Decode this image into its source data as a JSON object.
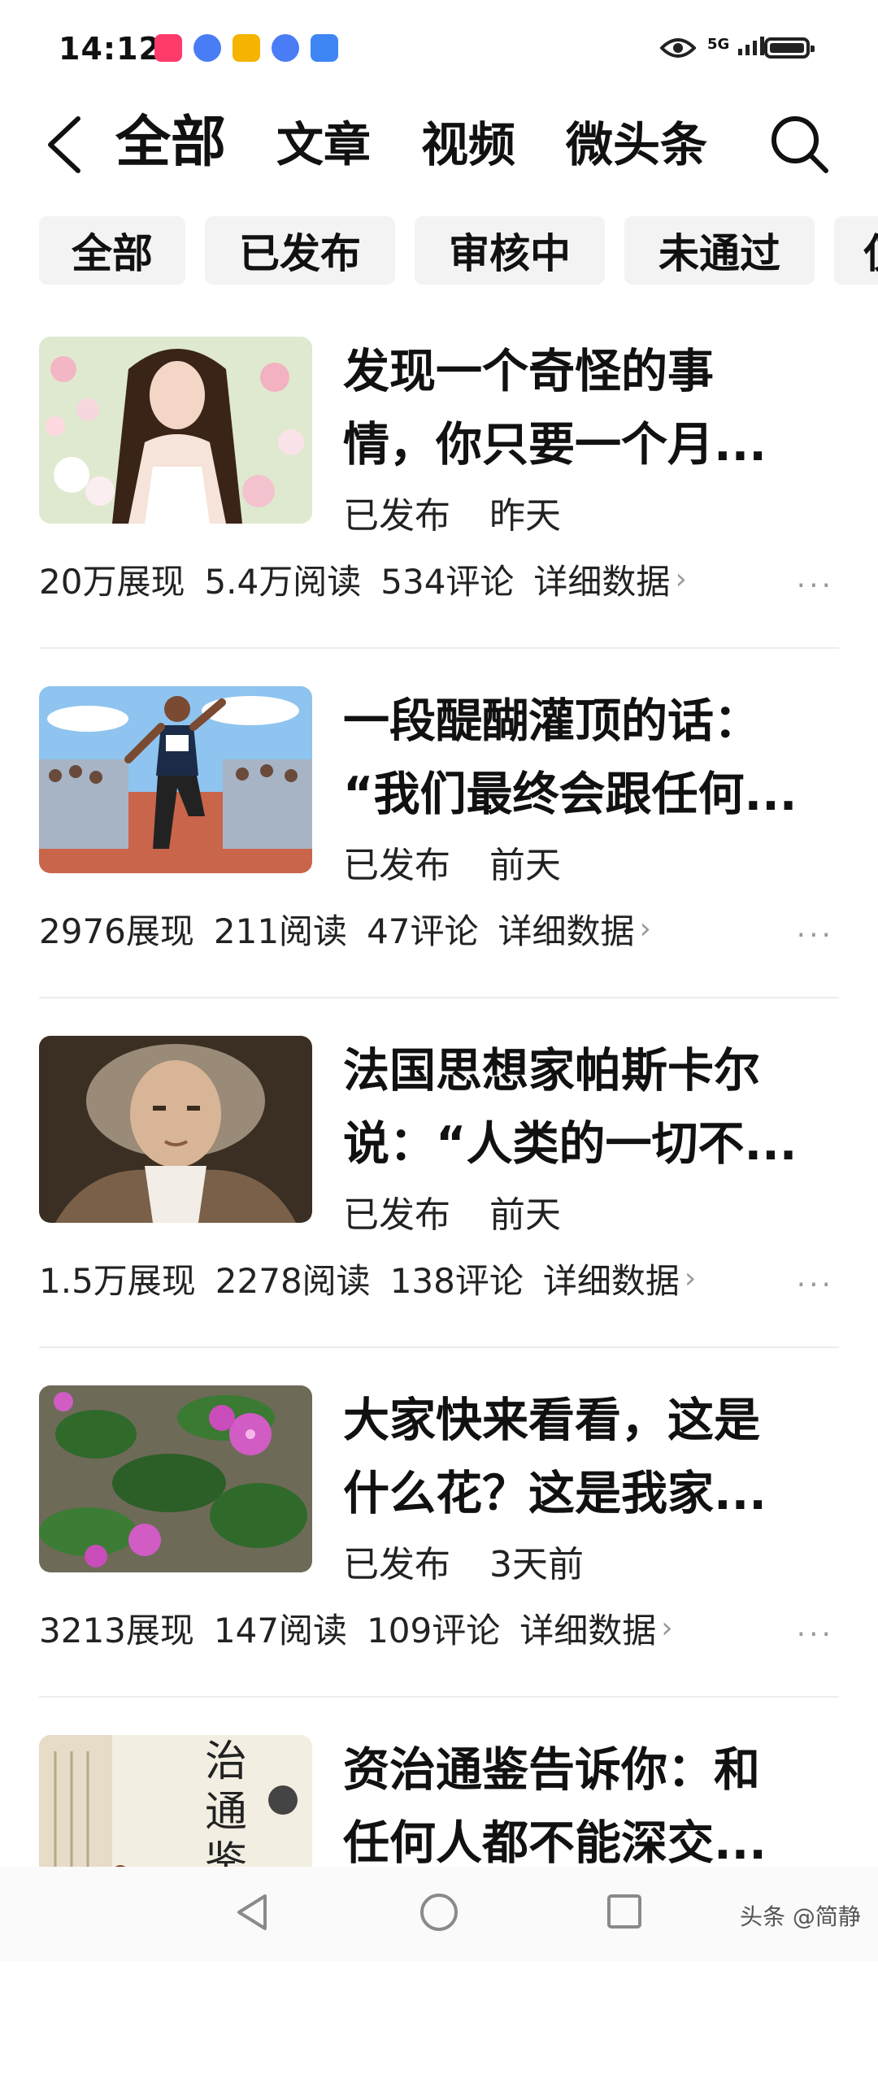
{
  "status_bar": {
    "time": "14:12",
    "network": "5G"
  },
  "header": {
    "tabs": [
      "全部",
      "文章",
      "视频",
      "微头条"
    ]
  },
  "filters": [
    "全部",
    "已发布",
    "审核中",
    "未通过",
    "仅"
  ],
  "articles": [
    {
      "title_line1": "发现一个奇怪的事",
      "title_line2": "情，你只要一个月...",
      "status": "已发布",
      "date": "昨天",
      "impressions": "20万展现",
      "reads": "5.4万阅读",
      "comments": "534评论",
      "detail": "详细数据"
    },
    {
      "title_line1": "一段醍醐灌顶的话：",
      "title_line2": "“我们最终会跟任何...",
      "status": "已发布",
      "date": "前天",
      "impressions": "2976展现",
      "reads": "211阅读",
      "comments": "47评论",
      "detail": "详细数据"
    },
    {
      "title_line1": "法国思想家帕斯卡尔",
      "title_line2": "说：“人类的一切不...",
      "status": "已发布",
      "date": "前天",
      "impressions": "1.5万展现",
      "reads": "2278阅读",
      "comments": "138评论",
      "detail": "详细数据"
    },
    {
      "title_line1": "大家快来看看，这是",
      "title_line2": "什么花？这是我家...",
      "status": "已发布",
      "date": "3天前",
      "impressions": "3213展现",
      "reads": "147阅读",
      "comments": "109评论",
      "detail": "详细数据"
    },
    {
      "title_line1": "资治通鉴告诉你：和",
      "title_line2": "任何人都不能深交..."
    }
  ],
  "thumbnail_text": {
    "book_cover": "治通鉴"
  },
  "watermark": "头条 @简静",
  "icons": {
    "back": "chevron-left-icon",
    "search": "search-icon",
    "more": "more-dots-icon",
    "nav_back": "triangle-back-icon",
    "nav_home": "circle-home-icon",
    "nav_recent": "square-recent-icon"
  }
}
